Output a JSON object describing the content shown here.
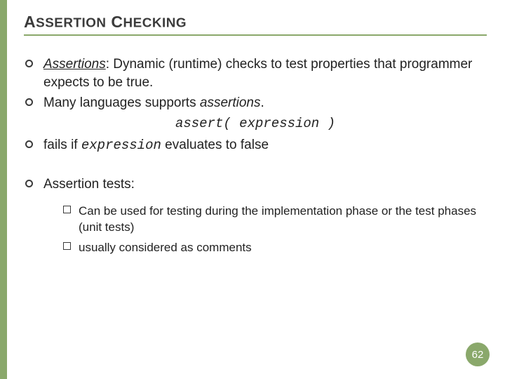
{
  "title_parts": {
    "a1": "A",
    "a_rest": "SSERTION",
    "c1": "C",
    "c_rest": "HECKING"
  },
  "bullets": [
    {
      "segments": [
        {
          "text": "Assertions",
          "style": "ital uline"
        },
        {
          "text": ": Dynamic (runtime) checks to test properties that programmer expects to be true."
        }
      ]
    },
    {
      "segments": [
        {
          "text": "Many languages supports "
        },
        {
          "text": "assertions",
          "style": "ital"
        },
        {
          "text": "."
        }
      ]
    }
  ],
  "code_line": "assert( expression )",
  "bullet_fails": {
    "segments": [
      {
        "text": "fails if "
      },
      {
        "text": "expression",
        "style": "mono ital"
      },
      {
        "text": " evaluates to false"
      }
    ]
  },
  "bullet_tests_label": "Assertion tests:",
  "sub_bullets": [
    "Can be used for testing during the implementation phase or the test phases (unit tests)",
    "usually considered as comments"
  ],
  "page_number": "62"
}
